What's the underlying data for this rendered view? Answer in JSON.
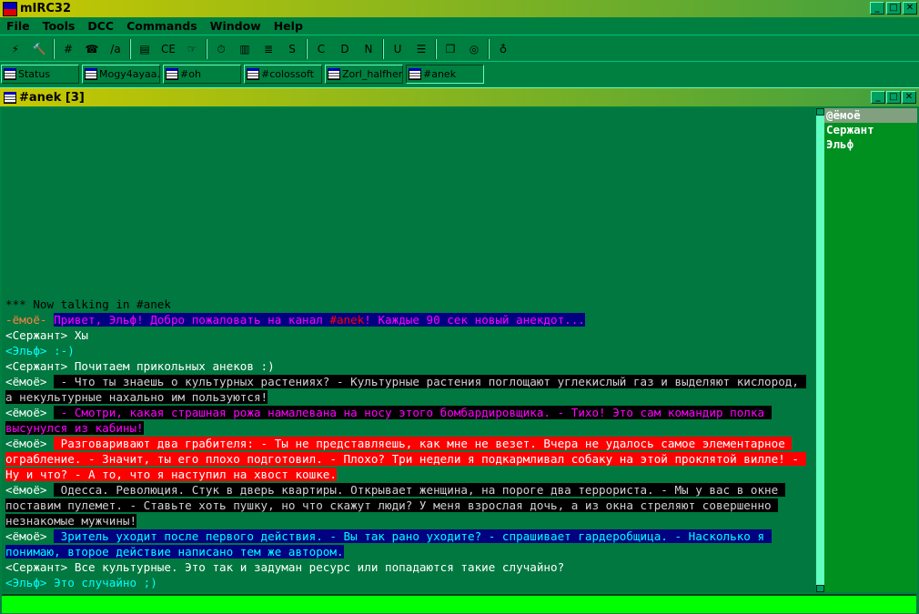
{
  "app": {
    "title": "mIRC32"
  },
  "menu": [
    "File",
    "Tools",
    "DCC",
    "Commands",
    "Window",
    "Help"
  ],
  "toolbar": [
    "connect-icon",
    "options-icon",
    "channels-folder-icon",
    "address-book-icon",
    "aliases-icon",
    "popups-icon",
    "scripts-icon",
    "notify-icon",
    "timer-icon",
    "colors-icon",
    "log-icon",
    "dcc-send-icon",
    "dcc-chat-icon",
    "dcc-options-icon",
    "notify-list-icon",
    "url-list-icon",
    "tile-icon",
    "cascade-icon",
    "help-icon",
    "about-icon"
  ],
  "switchbar": [
    {
      "label": "Status"
    },
    {
      "label": "Mogy4ayaa..."
    },
    {
      "label": "#oh"
    },
    {
      "label": "#colossoft"
    },
    {
      "label": "Zorl_halfhere"
    },
    {
      "label": "#anek",
      "active": true
    }
  ],
  "window": {
    "title": "#anek [3]"
  },
  "chat": [
    {
      "segs": [
        {
          "t": "*** Now talking in #anek",
          "c": "#000000"
        }
      ]
    },
    {
      "segs": [
        {
          "t": "-ёмоё- ",
          "c": "#ff8040"
        },
        {
          "t": "Привет, Эльф! Добро пожаловать на канал ",
          "c": "#ff00ff",
          "b": "#000080"
        },
        {
          "t": "#anek",
          "c": "#ff0000",
          "b": "#000080"
        },
        {
          "t": "! Каждые 90 сек новый анекдот...",
          "c": "#ff00ff",
          "b": "#000080"
        }
      ]
    },
    {
      "segs": [
        {
          "t": "<Сержант> Хы",
          "c": "#ffffff"
        }
      ]
    },
    {
      "segs": [
        {
          "t": "<Эльф> :-)",
          "c": "#00ffff"
        }
      ]
    },
    {
      "segs": [
        {
          "t": "<Сержант> Почитаем прикольных анеков :)",
          "c": "#ffffff"
        }
      ]
    },
    {
      "segs": [
        {
          "t": "<ёмоё> ",
          "c": "#ffffff"
        },
        {
          "t": " - Что ты знаешь о культурных растениях? - Культурные растения поглощают углекислый газ и выделяют кислород, а некультурные нахально им пользуются!",
          "c": "#d0d0d0",
          "b": "#000000"
        }
      ]
    },
    {
      "segs": [
        {
          "t": "<ёмоё> ",
          "c": "#ffffff"
        },
        {
          "t": " - Смотри, какая страшная рожа намалевана на носу этого бомбардировщика. - Тихо! Это сам командир полка высунулся из кабины!",
          "c": "#ff00ff",
          "b": "#000000"
        }
      ]
    },
    {
      "segs": [
        {
          "t": "<ёмоё> ",
          "c": "#ffffff"
        },
        {
          "t": " Разговаривают два грабителя: - Ты не представляешь, как мне не везет. Вчера не удалось самое элементарное ограбление. - Значит, ты его плохо подготовил. - Плохо? Три недели я подкармливал собаку на этой проклятой вилле! - Ну и что? - А то, что я наступил на хвост кошке.",
          "c": "#ffffff",
          "b": "#ff0000"
        }
      ]
    },
    {
      "segs": [
        {
          "t": "<ёмоё> ",
          "c": "#ffffff"
        },
        {
          "t": " Одесса. Революция. Стук в дверь квартиры. Открывает женщина, на пороге два террориста. - Мы у вас в окне поставим пулемет. - Ставьте хоть пушку, но что скажут люди? У меня взрослая дочь, а из окна стреляют совершенно незнакомые мужчины!",
          "c": "#d0d0d0",
          "b": "#000000"
        }
      ]
    },
    {
      "segs": [
        {
          "t": "<ёмоё> ",
          "c": "#ffffff"
        },
        {
          "t": " Зритель уходит после первого действия. - Вы так рано уходите? - спрашивает гардеробщица. - Насколько я понимаю, второе действие написано тем же автором.",
          "c": "#00ffff",
          "b": "#000080"
        }
      ]
    },
    {
      "segs": [
        {
          "t": "<Сержант> Все культурные. Это так и задуман ресурс или попадаются такие случайно?",
          "c": "#ffffff"
        }
      ]
    },
    {
      "segs": [
        {
          "t": "<Эльф> Это случайно ;)",
          "c": "#00ffff"
        }
      ]
    }
  ],
  "nicklist": [
    {
      "nick": "@ёмоё",
      "selected": true
    },
    {
      "nick": "Сержант"
    },
    {
      "nick": "Эльф"
    }
  ],
  "input": {
    "value": ""
  }
}
